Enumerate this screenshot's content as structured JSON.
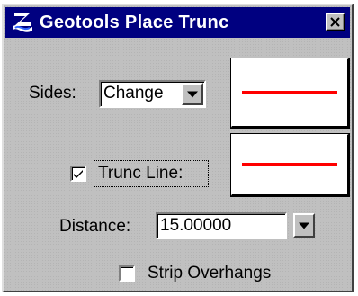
{
  "window": {
    "title": "Geotools Place Trunc"
  },
  "sides": {
    "label": "Sides:",
    "value": "Change"
  },
  "trunc_line": {
    "label": "Trunc Line:",
    "checked": true
  },
  "distance": {
    "label": "Distance:",
    "value": "15.00000"
  },
  "strip_overhangs": {
    "label": "Strip Overhangs",
    "checked": false
  },
  "colors": {
    "titlebar": "#000080",
    "line_preview": "#ff0000",
    "dialog_bg": "#c0c0c0"
  },
  "icons": {
    "app": "geotools-app-icon",
    "close": "close-icon",
    "dropdown": "chevron-down-icon",
    "check": "check-icon"
  }
}
